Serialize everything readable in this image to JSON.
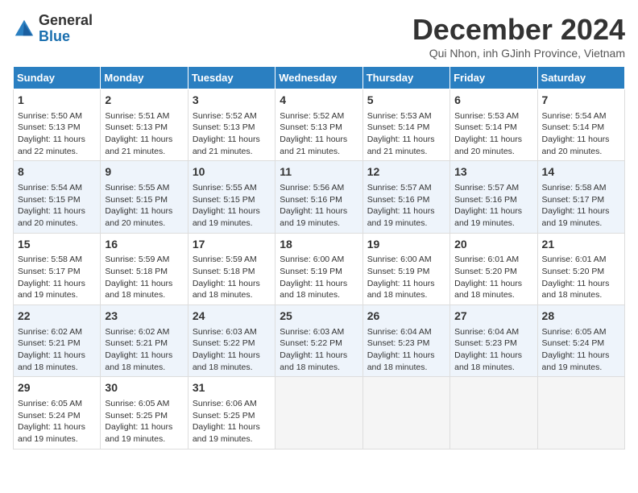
{
  "logo": {
    "line1": "General",
    "line2": "Blue"
  },
  "title": "December 2024",
  "subtitle": "Qui Nhon, inh GJinh Province, Vietnam",
  "headers": [
    "Sunday",
    "Monday",
    "Tuesday",
    "Wednesday",
    "Thursday",
    "Friday",
    "Saturday"
  ],
  "weeks": [
    [
      {
        "day": "1",
        "lines": [
          "Sunrise: 5:50 AM",
          "Sunset: 5:13 PM",
          "Daylight: 11 hours",
          "and 22 minutes."
        ]
      },
      {
        "day": "2",
        "lines": [
          "Sunrise: 5:51 AM",
          "Sunset: 5:13 PM",
          "Daylight: 11 hours",
          "and 21 minutes."
        ]
      },
      {
        "day": "3",
        "lines": [
          "Sunrise: 5:52 AM",
          "Sunset: 5:13 PM",
          "Daylight: 11 hours",
          "and 21 minutes."
        ]
      },
      {
        "day": "4",
        "lines": [
          "Sunrise: 5:52 AM",
          "Sunset: 5:13 PM",
          "Daylight: 11 hours",
          "and 21 minutes."
        ]
      },
      {
        "day": "5",
        "lines": [
          "Sunrise: 5:53 AM",
          "Sunset: 5:14 PM",
          "Daylight: 11 hours",
          "and 21 minutes."
        ]
      },
      {
        "day": "6",
        "lines": [
          "Sunrise: 5:53 AM",
          "Sunset: 5:14 PM",
          "Daylight: 11 hours",
          "and 20 minutes."
        ]
      },
      {
        "day": "7",
        "lines": [
          "Sunrise: 5:54 AM",
          "Sunset: 5:14 PM",
          "Daylight: 11 hours",
          "and 20 minutes."
        ]
      }
    ],
    [
      {
        "day": "8",
        "lines": [
          "Sunrise: 5:54 AM",
          "Sunset: 5:15 PM",
          "Daylight: 11 hours",
          "and 20 minutes."
        ]
      },
      {
        "day": "9",
        "lines": [
          "Sunrise: 5:55 AM",
          "Sunset: 5:15 PM",
          "Daylight: 11 hours",
          "and 20 minutes."
        ]
      },
      {
        "day": "10",
        "lines": [
          "Sunrise: 5:55 AM",
          "Sunset: 5:15 PM",
          "Daylight: 11 hours",
          "and 19 minutes."
        ]
      },
      {
        "day": "11",
        "lines": [
          "Sunrise: 5:56 AM",
          "Sunset: 5:16 PM",
          "Daylight: 11 hours",
          "and 19 minutes."
        ]
      },
      {
        "day": "12",
        "lines": [
          "Sunrise: 5:57 AM",
          "Sunset: 5:16 PM",
          "Daylight: 11 hours",
          "and 19 minutes."
        ]
      },
      {
        "day": "13",
        "lines": [
          "Sunrise: 5:57 AM",
          "Sunset: 5:16 PM",
          "Daylight: 11 hours",
          "and 19 minutes."
        ]
      },
      {
        "day": "14",
        "lines": [
          "Sunrise: 5:58 AM",
          "Sunset: 5:17 PM",
          "Daylight: 11 hours",
          "and 19 minutes."
        ]
      }
    ],
    [
      {
        "day": "15",
        "lines": [
          "Sunrise: 5:58 AM",
          "Sunset: 5:17 PM",
          "Daylight: 11 hours",
          "and 19 minutes."
        ]
      },
      {
        "day": "16",
        "lines": [
          "Sunrise: 5:59 AM",
          "Sunset: 5:18 PM",
          "Daylight: 11 hours",
          "and 18 minutes."
        ]
      },
      {
        "day": "17",
        "lines": [
          "Sunrise: 5:59 AM",
          "Sunset: 5:18 PM",
          "Daylight: 11 hours",
          "and 18 minutes."
        ]
      },
      {
        "day": "18",
        "lines": [
          "Sunrise: 6:00 AM",
          "Sunset: 5:19 PM",
          "Daylight: 11 hours",
          "and 18 minutes."
        ]
      },
      {
        "day": "19",
        "lines": [
          "Sunrise: 6:00 AM",
          "Sunset: 5:19 PM",
          "Daylight: 11 hours",
          "and 18 minutes."
        ]
      },
      {
        "day": "20",
        "lines": [
          "Sunrise: 6:01 AM",
          "Sunset: 5:20 PM",
          "Daylight: 11 hours",
          "and 18 minutes."
        ]
      },
      {
        "day": "21",
        "lines": [
          "Sunrise: 6:01 AM",
          "Sunset: 5:20 PM",
          "Daylight: 11 hours",
          "and 18 minutes."
        ]
      }
    ],
    [
      {
        "day": "22",
        "lines": [
          "Sunrise: 6:02 AM",
          "Sunset: 5:21 PM",
          "Daylight: 11 hours",
          "and 18 minutes."
        ]
      },
      {
        "day": "23",
        "lines": [
          "Sunrise: 6:02 AM",
          "Sunset: 5:21 PM",
          "Daylight: 11 hours",
          "and 18 minutes."
        ]
      },
      {
        "day": "24",
        "lines": [
          "Sunrise: 6:03 AM",
          "Sunset: 5:22 PM",
          "Daylight: 11 hours",
          "and 18 minutes."
        ]
      },
      {
        "day": "25",
        "lines": [
          "Sunrise: 6:03 AM",
          "Sunset: 5:22 PM",
          "Daylight: 11 hours",
          "and 18 minutes."
        ]
      },
      {
        "day": "26",
        "lines": [
          "Sunrise: 6:04 AM",
          "Sunset: 5:23 PM",
          "Daylight: 11 hours",
          "and 18 minutes."
        ]
      },
      {
        "day": "27",
        "lines": [
          "Sunrise: 6:04 AM",
          "Sunset: 5:23 PM",
          "Daylight: 11 hours",
          "and 18 minutes."
        ]
      },
      {
        "day": "28",
        "lines": [
          "Sunrise: 6:05 AM",
          "Sunset: 5:24 PM",
          "Daylight: 11 hours",
          "and 19 minutes."
        ]
      }
    ],
    [
      {
        "day": "29",
        "lines": [
          "Sunrise: 6:05 AM",
          "Sunset: 5:24 PM",
          "Daylight: 11 hours",
          "and 19 minutes."
        ]
      },
      {
        "day": "30",
        "lines": [
          "Sunrise: 6:05 AM",
          "Sunset: 5:25 PM",
          "Daylight: 11 hours",
          "and 19 minutes."
        ]
      },
      {
        "day": "31",
        "lines": [
          "Sunrise: 6:06 AM",
          "Sunset: 5:25 PM",
          "Daylight: 11 hours",
          "and 19 minutes."
        ]
      },
      {
        "day": "",
        "lines": []
      },
      {
        "day": "",
        "lines": []
      },
      {
        "day": "",
        "lines": []
      },
      {
        "day": "",
        "lines": []
      }
    ]
  ]
}
